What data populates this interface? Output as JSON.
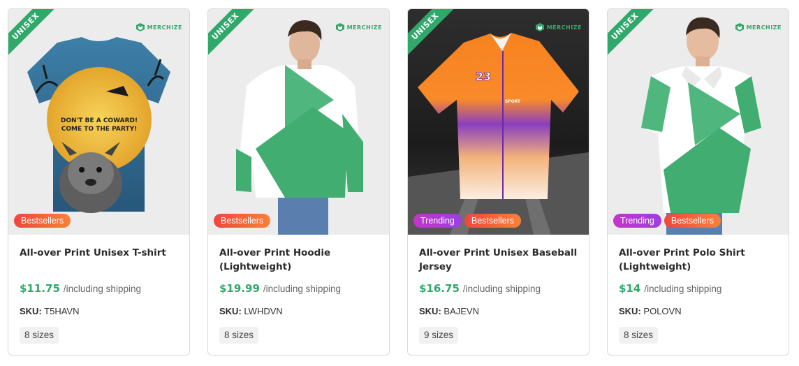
{
  "products": [
    {
      "title": "All-over Print Unisex T-shirt",
      "price": "$11.75",
      "shipping": "/including shipping",
      "sku_label": "SKU:",
      "sku": "T5HAVN",
      "sizes": "8 sizes",
      "ribbon": "UNISEX",
      "brand": "MERCHIZE",
      "badges": [
        "Bestsellers"
      ],
      "graphic_text": "DON'T BE A COWARD! COME TO THE PARTY!"
    },
    {
      "title": "All-over Print Hoodie (Lightweight)",
      "price": "$19.99",
      "shipping": "/including shipping",
      "sku_label": "SKU:",
      "sku": "LWHDVN",
      "sizes": "8 sizes",
      "ribbon": "UNISEX",
      "brand": "MERCHIZE",
      "badges": [
        "Bestsellers"
      ]
    },
    {
      "title": "All-over Print Unisex Baseball Jersey",
      "price": "$16.75",
      "shipping": "/including shipping",
      "sku_label": "SKU:",
      "sku": "BAJEVN",
      "sizes": "9 sizes",
      "ribbon": "UNISEX",
      "brand": "MERCHIZE",
      "badges": [
        "Trending",
        "Bestsellers"
      ],
      "jersey_number": "23",
      "jersey_sub": "SPORT"
    },
    {
      "title": "All-over Print Polo Shirt (Lightweight)",
      "price": "$14",
      "shipping": "/including shipping",
      "sku_label": "SKU:",
      "sku": "POLOVN",
      "sizes": "8 sizes",
      "ribbon": "UNISEX",
      "brand": "MERCHIZE",
      "badges": [
        "Trending",
        "Bestsellers"
      ]
    }
  ],
  "colors": {
    "accent_green": "#2fa86a",
    "bestseller_gradient": [
      "#f0463c",
      "#f7813a"
    ],
    "trending_gradient": [
      "#c535c9",
      "#9b3fe3"
    ]
  }
}
